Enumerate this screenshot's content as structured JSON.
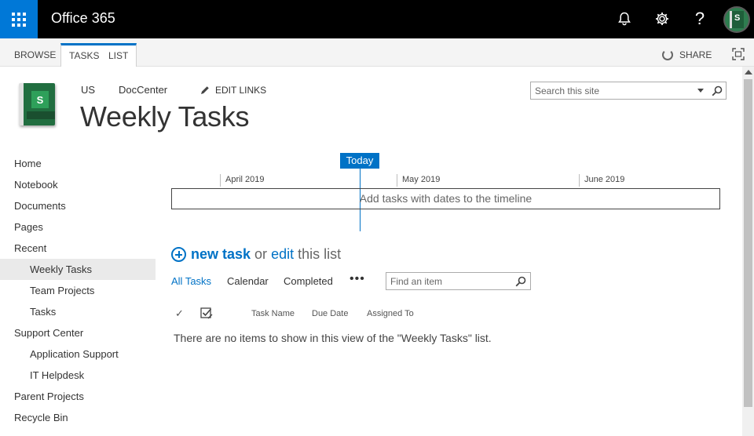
{
  "suite": {
    "title": "Office 365",
    "icons": [
      "waffle-icon",
      "bell-icon",
      "gear-icon",
      "help-icon",
      "avatar"
    ],
    "help_glyph": "?"
  },
  "ribbon": {
    "tabs": [
      "BROWSE",
      "TASKS",
      "LIST"
    ],
    "share_label": "SHARE"
  },
  "site": {
    "top_nav": [
      "US",
      "DocCenter"
    ],
    "edit_links": "EDIT LINKS",
    "page_title": "Weekly Tasks",
    "search_placeholder": "Search this site"
  },
  "left_nav": [
    {
      "label": "Home",
      "level": 0,
      "selected": false
    },
    {
      "label": "Notebook",
      "level": 0,
      "selected": false
    },
    {
      "label": "Documents",
      "level": 0,
      "selected": false
    },
    {
      "label": "Pages",
      "level": 0,
      "selected": false
    },
    {
      "label": "Recent",
      "level": 0,
      "selected": false
    },
    {
      "label": "Weekly Tasks",
      "level": 1,
      "selected": true
    },
    {
      "label": "Team Projects",
      "level": 1,
      "selected": false
    },
    {
      "label": "Tasks",
      "level": 1,
      "selected": false
    },
    {
      "label": "Support Center",
      "level": 0,
      "selected": false
    },
    {
      "label": "Application Support",
      "level": 1,
      "selected": false
    },
    {
      "label": "IT Helpdesk",
      "level": 1,
      "selected": false
    },
    {
      "label": "Parent Projects",
      "level": 0,
      "selected": false
    },
    {
      "label": "Recycle Bin",
      "level": 0,
      "selected": false
    }
  ],
  "timeline": {
    "today_label": "Today",
    "months": [
      "April 2019",
      "May 2019",
      "June 2019"
    ],
    "empty_text": "Add tasks with dates to the timeline"
  },
  "list": {
    "new_task": "new task",
    "or": "or",
    "edit": "edit",
    "this_list": "this list",
    "views": [
      "All Tasks",
      "Calendar",
      "Completed"
    ],
    "more": "•••",
    "find_placeholder": "Find an item",
    "check_glyph": "✓",
    "columns": [
      "Task Name",
      "Due Date",
      "Assigned To"
    ],
    "empty_message": "There are no items to show in this view of the \"Weekly Tasks\" list."
  },
  "colors": {
    "suite_bar": "#000000",
    "waffle": "#0078d7",
    "accent": "#0072c6",
    "logo_green": "#216e40"
  }
}
